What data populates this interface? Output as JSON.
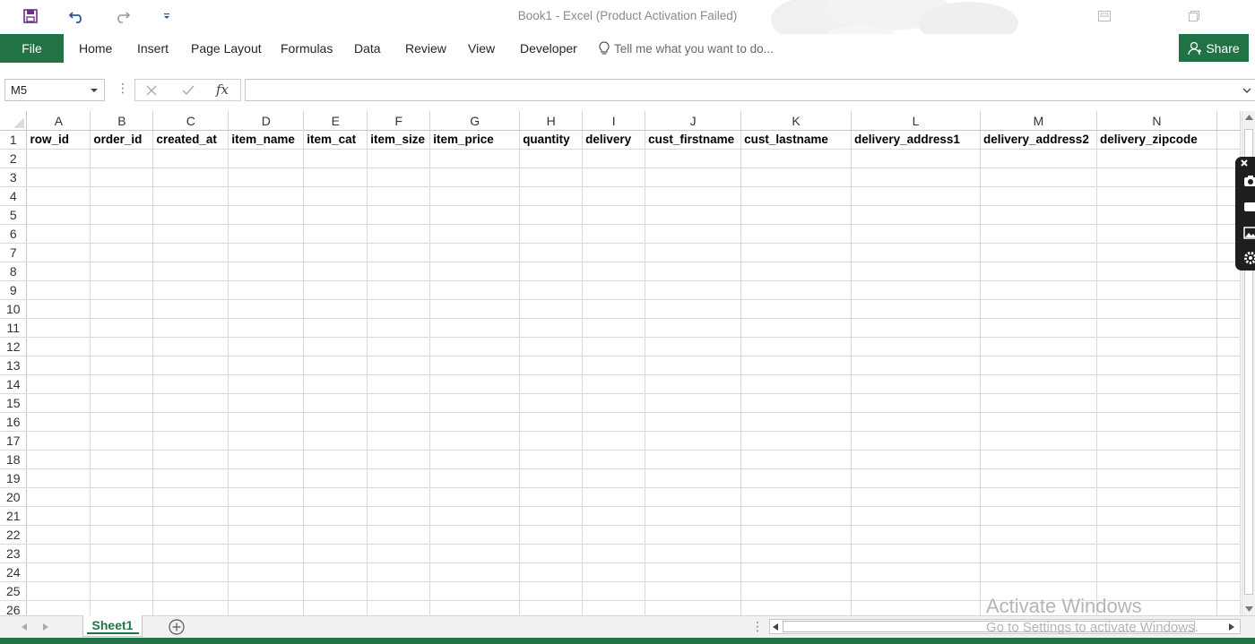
{
  "window": {
    "title": "Book1 - Excel (Product Activation Failed)"
  },
  "ribbon": {
    "file_label": "File",
    "tabs": [
      "Home",
      "Insert",
      "Page Layout",
      "Formulas",
      "Data",
      "Review",
      "View",
      "Developer"
    ],
    "tell_me_placeholder": "Tell me what you want to do...",
    "share_label": "Share"
  },
  "formula_bar": {
    "name_box": "M5",
    "formula_value": "",
    "fx_label": "fx"
  },
  "sheet": {
    "columns": [
      "A",
      "B",
      "C",
      "D",
      "E",
      "F",
      "G",
      "H",
      "I",
      "J",
      "K",
      "L",
      "M",
      "N"
    ],
    "header_row": [
      "row_id",
      "order_id",
      "created_at",
      "item_name",
      "item_cat",
      "item_size",
      "item_price",
      "quantity",
      "delivery",
      "cust_firstname",
      "cust_lastname",
      "delivery_address1",
      "delivery_address2",
      "delivery_zipcode"
    ],
    "row_numbers": [
      "1",
      "2",
      "3",
      "4",
      "5",
      "6",
      "7",
      "8",
      "9",
      "10",
      "11",
      "12",
      "13",
      "14",
      "15",
      "16",
      "17",
      "18",
      "19",
      "20",
      "21",
      "22",
      "23",
      "24",
      "25",
      "26"
    ]
  },
  "sheet_tabs": {
    "active": "Sheet1"
  },
  "watermark": {
    "title": "Activate Windows",
    "subtitle": "Go to Settings to activate Windows."
  },
  "colors": {
    "accent": "#217346"
  },
  "icons": [
    "save-icon",
    "undo-icon",
    "redo-icon",
    "customize-qat-icon",
    "ribbon-display-icon",
    "restore-icon",
    "lightbulb-icon",
    "person-icon",
    "cancel-icon",
    "enter-icon",
    "camera-icon",
    "video-icon",
    "image-icon",
    "settings-icon",
    "add-sheet-icon"
  ]
}
